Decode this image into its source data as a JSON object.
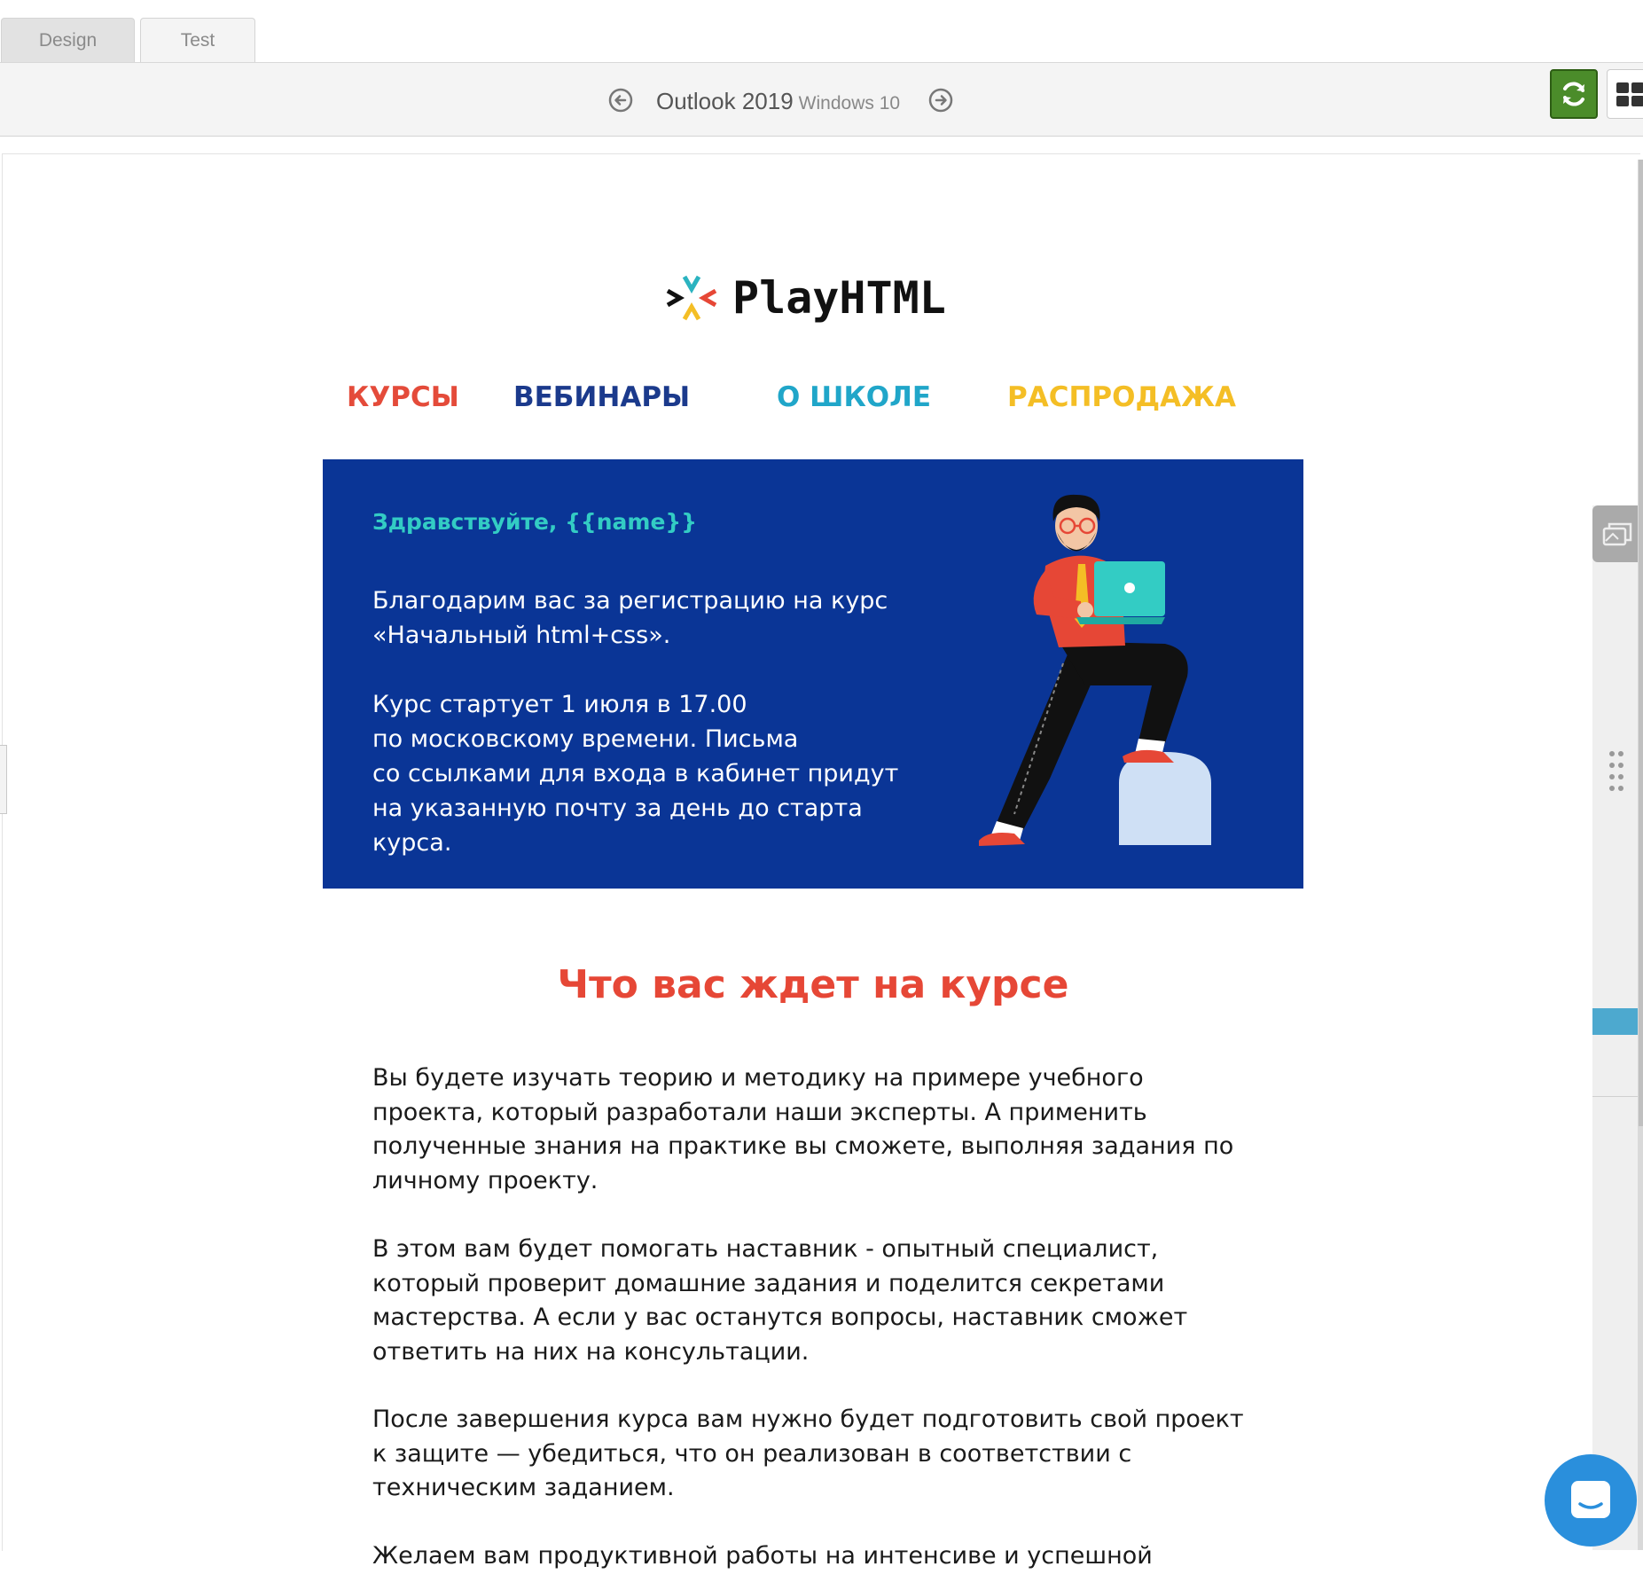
{
  "tabs": [
    {
      "label": "Design"
    },
    {
      "label": "Test"
    }
  ],
  "toolbar": {
    "client_name": "Outlook 2019",
    "client_os": "Windows 10",
    "prev_icon": "arrow-left-circle-icon",
    "next_icon": "arrow-right-circle-icon",
    "refresh_icon": "refresh-icon",
    "grid_icon": "grid-icon"
  },
  "colors": {
    "accent_green": "#4b8c2a",
    "hero_blue": "#0a3596",
    "title_red": "#e64736",
    "menu_red": "#e44b3a",
    "menu_blue": "#1b3a8c",
    "menu_cyan": "#20a6c9",
    "menu_yellow": "#f4be25",
    "greeting_teal": "#33ccc4",
    "chat_blue": "#2a8fdc"
  },
  "email": {
    "logo_text": "PlayHTML",
    "menu": [
      "КУРСЫ",
      "ВЕБИНАРЫ",
      "О ШКОЛЕ",
      "РАСПРОДАЖА"
    ],
    "hero": {
      "greeting": "Здравствуйте, {{name}}",
      "paragraph1": [
        "Благодарим вас за регистрацию на курс",
        "«Начальный html+css»."
      ],
      "paragraph2": [
        "Курс стартует 1 июля в 17.00",
        "по московскому времени. Письма",
        "со ссылками для входа в кабинет придут",
        "на указанную почту за день до старта",
        "курса."
      ]
    },
    "section_title": "Что вас ждет на курсе",
    "body_paragraphs": [
      [
        "Вы будете изучать теорию и методику на примере учебного",
        "проекта, который разработали наши эксперты. А применить",
        "полученные знания на практике вы сможете, выполняя задания по",
        "личному проекту."
      ],
      [
        "В этом вам будет помогать наставник - опытный специалист,",
        "который проверит домашние задания и поделится секретами",
        "мастерства. А если у вас останутся вопросы, наставник сможет",
        "ответить на них на консультации."
      ],
      [
        "После завершения курса вам нужно будет подготовить свой проект",
        "к защите — убедиться, что он реализован в соответствии с",
        "техническим заданием."
      ],
      [
        "Желаем вам продуктивной работы на интенсиве и успешной"
      ]
    ]
  },
  "side_panel": {
    "screenshots_icon": "screenshots-icon",
    "drag_handle_icon": "drag-handle-icon"
  },
  "chat_widget": {
    "icon": "chat-icon"
  }
}
